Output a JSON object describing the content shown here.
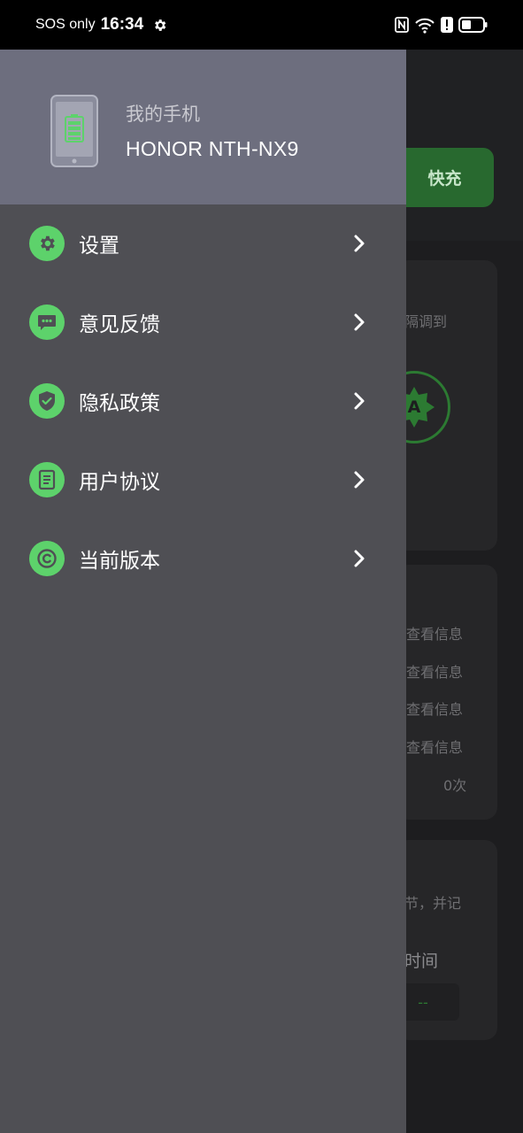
{
  "status_bar": {
    "carrier": "SOS only",
    "time": "16:34",
    "icons": [
      "settings-icon",
      "nfc-icon",
      "wifi-icon",
      "alert-icon",
      "battery-icon"
    ]
  },
  "background": {
    "fast_charge_button": "快充",
    "card1_text": "隔调到",
    "card1_badge": "A",
    "info_rows": [
      "查看信息",
      "查看信息",
      "查看信息",
      "查看信息"
    ],
    "count": "0次",
    "card3_text": "节，并记",
    "card3_time_label": "时间",
    "card3_value": "--"
  },
  "drawer": {
    "header": {
      "label": "我的手机",
      "device": "HONOR NTH-NX9"
    },
    "menu": [
      {
        "label": "设置",
        "icon": "gear-icon"
      },
      {
        "label": "意见反馈",
        "icon": "chat-icon"
      },
      {
        "label": "隐私政策",
        "icon": "shield-icon"
      },
      {
        "label": "用户协议",
        "icon": "document-icon"
      },
      {
        "label": "当前版本",
        "icon": "copyright-icon"
      }
    ]
  },
  "colors": {
    "accent": "#5dd26b",
    "drawer_bg": "#4f4f54",
    "header_bg": "#6d6e7e"
  }
}
